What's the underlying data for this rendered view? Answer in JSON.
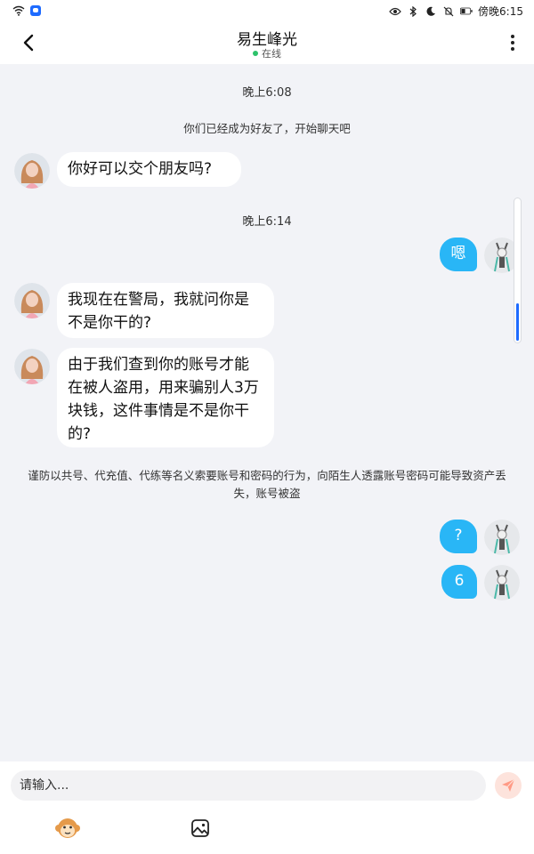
{
  "status_bar": {
    "time": "傍晚6:15",
    "left_icons": [
      "wifi-icon",
      "app-notification-icon"
    ],
    "right_icons": [
      "eye-icon",
      "bluetooth-icon",
      "moon-icon",
      "mute-icon",
      "battery-icon"
    ]
  },
  "header": {
    "title": "易生峰光",
    "status": "在线",
    "status_color": "#2dc26b",
    "back_icon": "chevron-left-icon",
    "menu_icon": "more-vertical-icon"
  },
  "chat": {
    "timestamp_1": "晚上6:08",
    "system_notice": "你们已经成为好友了，开始聊天吧",
    "msg_1": "你好可以交个朋友吗?",
    "timestamp_2": "晚上6:14",
    "msg_2": "嗯",
    "msg_3": "我现在在警局，我就问你是不是你干的?",
    "msg_4": "由于我们查到你的账号才能在被人盗用，用来骗别人3万块钱，这件事情是不是你干的?",
    "warning": "谨防以共号、代充值、代练等名义索要账号和密码的行为，向陌生人透露账号密码可能导致资产丢失，账号被盗",
    "msg_5": "?",
    "msg_6": "6",
    "outgoing_bubble_color": "#29b6f6",
    "incoming_bubble_color": "#ffffff"
  },
  "composer": {
    "placeholder": "请输入...",
    "send_icon": "paper-plane-icon",
    "emoji_icon": "monkey-emoji-icon",
    "image_icon": "image-icon"
  }
}
